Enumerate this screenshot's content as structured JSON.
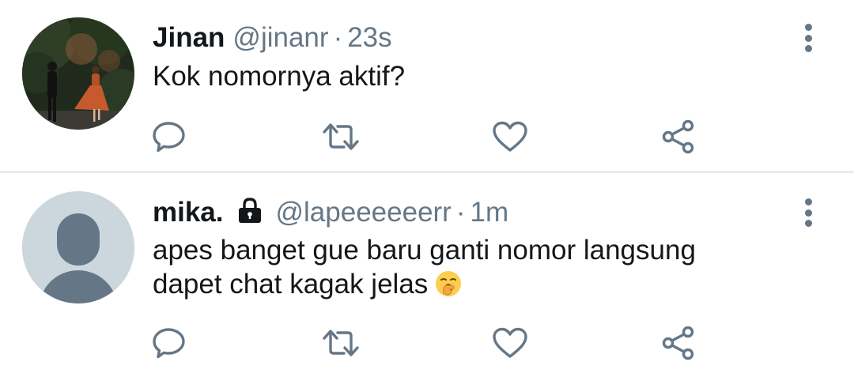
{
  "tweets": [
    {
      "name": "Jinan",
      "handle": "@jinanr",
      "separator": "·",
      "time": "23s",
      "text_lines": [
        "Kok nomornya aktif?"
      ],
      "avatar": "photo",
      "locked": false
    },
    {
      "name": "mika.",
      "handle": "@lapeeeeeerr",
      "separator": "·",
      "time": "1m",
      "text_lines": [
        "apes banget gue baru ganti nomor langsung",
        "dapet chat kagak jelas"
      ],
      "emoji": "🥱",
      "avatar": "default-silhouette",
      "locked": true
    }
  ],
  "icons": {
    "reply": "reply-icon",
    "retweet": "retweet-icon",
    "like": "heart-icon",
    "share": "share-icon",
    "menu": "more-vertical-icon",
    "lock": "lock-icon"
  },
  "colors": {
    "text": "#14171a",
    "secondary": "#657786",
    "divider": "#e6ecf0",
    "default_avatar_bg": "#ccd6dd",
    "default_avatar_fg": "#657786"
  }
}
